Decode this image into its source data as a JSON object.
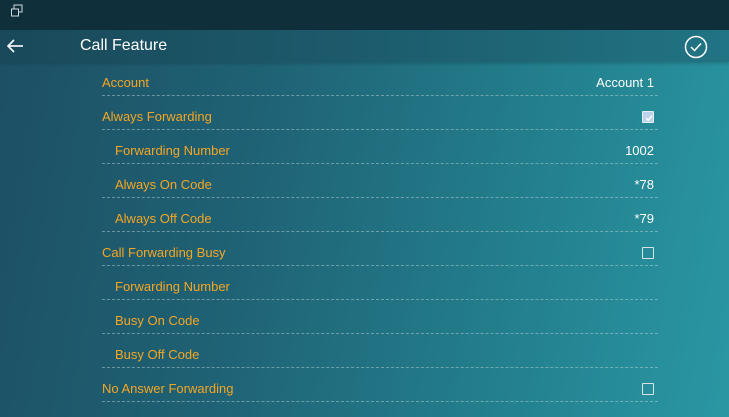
{
  "status_bar": {
    "icon": "window-restore-icon"
  },
  "header": {
    "back_icon": "arrow-left-icon",
    "title": "Call Feature",
    "confirm_icon": "check-circle-icon"
  },
  "rows": [
    {
      "label": "Account",
      "value": "Account 1",
      "indent": false
    },
    {
      "label": "Always Forwarding",
      "checkbox": true,
      "checked": true,
      "indent": false
    },
    {
      "label": "Forwarding Number",
      "value": "1002",
      "indent": true
    },
    {
      "label": "Always On Code",
      "value": "*78",
      "indent": true
    },
    {
      "label": "Always Off Code",
      "value": "*79",
      "indent": true
    },
    {
      "label": "Call Forwarding Busy",
      "checkbox": true,
      "checked": false,
      "indent": false
    },
    {
      "label": "Forwarding Number",
      "value": "",
      "indent": true
    },
    {
      "label": "Busy On Code",
      "value": "",
      "indent": true
    },
    {
      "label": "Busy Off Code",
      "value": "",
      "indent": true
    },
    {
      "label": "No Answer Forwarding",
      "checkbox": true,
      "checked": false,
      "indent": false
    }
  ],
  "colors": {
    "label": "#f5a623",
    "value": "#ffffff",
    "status_bar": "#0f2f3a",
    "background_start": "#1d4f63",
    "background_end": "#2a97a3"
  }
}
